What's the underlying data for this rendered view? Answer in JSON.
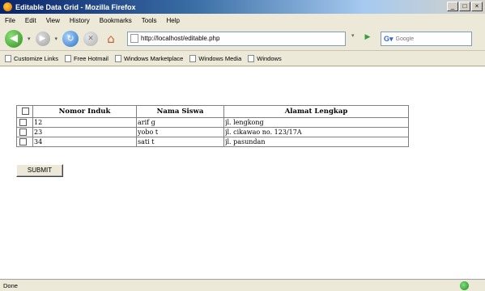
{
  "window": {
    "title": "Editable Data Grid - Mozilla Firefox",
    "controls": [
      "_",
      "□",
      "×"
    ]
  },
  "menu": [
    "File",
    "Edit",
    "View",
    "History",
    "Bookmarks",
    "Tools",
    "Help"
  ],
  "nav": {
    "url": "http://localhost/editable.php",
    "search_placeholder": "Google"
  },
  "bookmarks": [
    "Customize Links",
    "Free Hotmail",
    "Windows Marketplace",
    "Windows Media",
    "Windows"
  ],
  "grid": {
    "headers": [
      "Nomor Induk",
      "Nama Siswa",
      "Alamat Lengkap"
    ],
    "rows": [
      {
        "nomor": "12",
        "nama": "arif g",
        "alamat": "jl. lengkong"
      },
      {
        "nomor": "23",
        "nama": "yobo t",
        "alamat": "jl. cikawao no. 123/17A"
      },
      {
        "nomor": "34",
        "nama": "sati t",
        "alamat": "jl. pasundan"
      }
    ]
  },
  "submit_label": "SUBMIT",
  "status": "Done"
}
